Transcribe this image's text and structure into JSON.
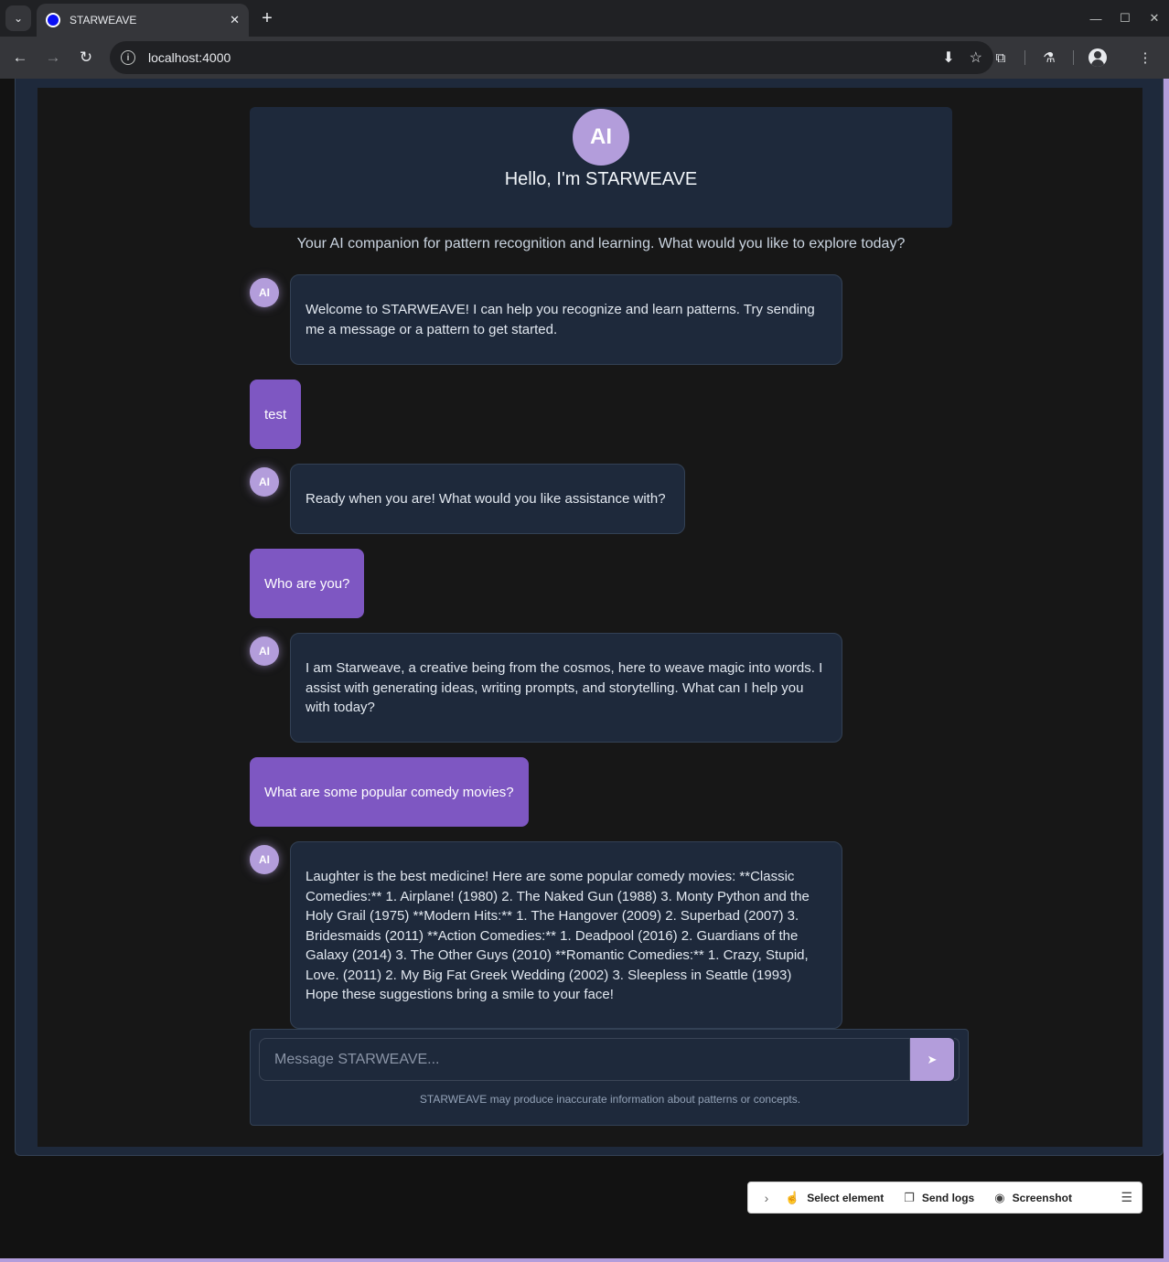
{
  "browser": {
    "tab_title": "STARWEAVE",
    "url": "localhost:4000",
    "new_tab": "+",
    "tab_close": "✕"
  },
  "welcome": {
    "avatar": "AI",
    "title": "Hello, I'm STARWEAVE",
    "subtitle": "Your AI companion for pattern recognition and learning. What would you like to explore today?"
  },
  "messages": [
    {
      "role": "ai",
      "avatar": "AI",
      "text": "Welcome to STARWEAVE! I can help you recognize and learn patterns. Try sending me a message or a pattern to get started."
    },
    {
      "role": "user",
      "text": "test"
    },
    {
      "role": "ai",
      "avatar": "AI",
      "text": "Ready when you are! What would you like assistance with?"
    },
    {
      "role": "user",
      "text": "Who are you?"
    },
    {
      "role": "ai",
      "avatar": "AI",
      "text": "I am Starweave, a creative being from the cosmos, here to weave magic into words. I assist with generating ideas, writing prompts, and storytelling. What can I help you with today?"
    },
    {
      "role": "user",
      "text": "What are some popular comedy movies?"
    },
    {
      "role": "ai",
      "avatar": "AI",
      "text": "Laughter is the best medicine! Here are some popular comedy movies: **Classic Comedies:** 1. Airplane! (1980) 2. The Naked Gun (1988) 3. Monty Python and the Holy Grail (1975) **Modern Hits:** 1. The Hangover (2009) 2. Superbad (2007) 3. Bridesmaids (2011) **Action Comedies:** 1. Deadpool (2016) 2. Guardians of the Galaxy (2014) 3. The Other Guys (2010) **Romantic Comedies:** 1. Crazy, Stupid, Love. (2011) 2. My Big Fat Greek Wedding (2002) 3. Sleepless in Seattle (1993) Hope these suggestions bring a smile to your face!"
    }
  ],
  "composer": {
    "placeholder": "Message STARWEAVE...",
    "value": "",
    "send_label": "➤",
    "disclaimer": "STARWEAVE may produce inaccurate information about patterns or concepts."
  },
  "devbar": {
    "select_element": "Select element",
    "send_logs": "Send logs",
    "screenshot": "Screenshot"
  },
  "colors": {
    "accent": "#b39ddb",
    "user_bubble": "#7e57c2",
    "panel": "#1e293b",
    "background": "#171717"
  }
}
